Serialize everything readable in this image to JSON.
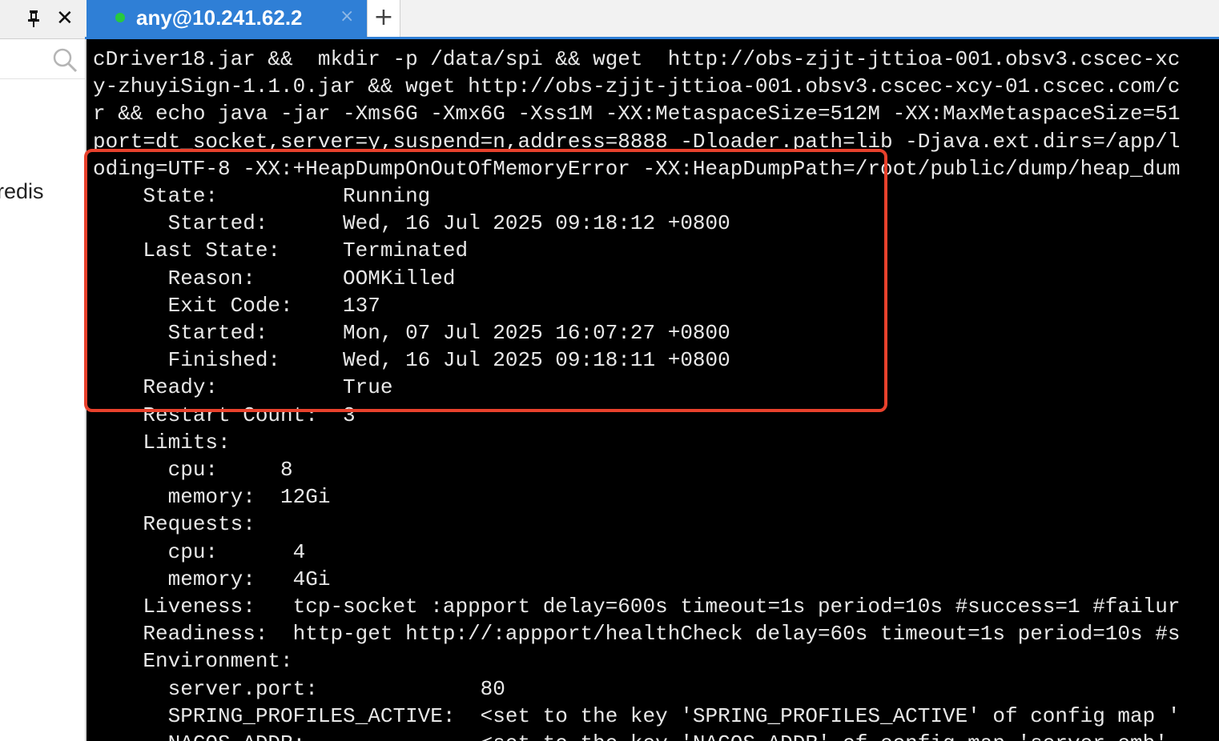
{
  "sidebar": {
    "item_label": "redis"
  },
  "tab": {
    "title": "any@10.241.62.2",
    "close_glyph": "×",
    "new_tab_glyph": "+",
    "status_color": "#27c93f",
    "accent_color": "#2f7fd6"
  },
  "window": {
    "close_glyph": "✕"
  },
  "terminal": {
    "lines": [
      "cDriver18.jar &&  mkdir -p /data/spi && wget  http://obs-zjjt-jttioa-001.obsv3.cscec-xc",
      "y-zhuyiSign-1.1.0.jar && wget http://obs-zjjt-jttioa-001.obsv3.cscec-xcy-01.cscec.com/c",
      "r && echo java -jar -Xms6G -Xmx6G -Xss1M -XX:MetaspaceSize=512M -XX:MaxMetaspaceSize=51",
      "port=dt_socket,server=y,suspend=n,address=8888 -Dloader.path=lib -Djava.ext.dirs=/app/l",
      "oding=UTF-8 -XX:+HeapDumpOnOutOfMemoryError -XX:HeapDumpPath=/root/public/dump/heap_dum",
      "    State:          Running",
      "      Started:      Wed, 16 Jul 2025 09:18:12 +0800",
      "    Last State:     Terminated",
      "      Reason:       OOMKilled",
      "      Exit Code:    137",
      "      Started:      Mon, 07 Jul 2025 16:07:27 +0800",
      "      Finished:     Wed, 16 Jul 2025 09:18:11 +0800",
      "    Ready:          True",
      "    Restart Count:  3",
      "    Limits:",
      "      cpu:     8",
      "      memory:  12Gi",
      "    Requests:",
      "      cpu:      4",
      "      memory:   4Gi",
      "    Liveness:   tcp-socket :appport delay=600s timeout=1s period=10s #success=1 #failur",
      "    Readiness:  http-get http://:appport/healthCheck delay=60s timeout=1s period=10s #s",
      "    Environment:",
      "      server.port:             80",
      "      SPRING_PROFILES_ACTIVE:  <set to the key 'SPRING_PROFILES_ACTIVE' of config map '",
      "      NACOS_ADDR:              <set to the key 'NACOS_ADDR' of config map 'server-cmb'"
    ],
    "highlight_color": "#e8412c"
  }
}
